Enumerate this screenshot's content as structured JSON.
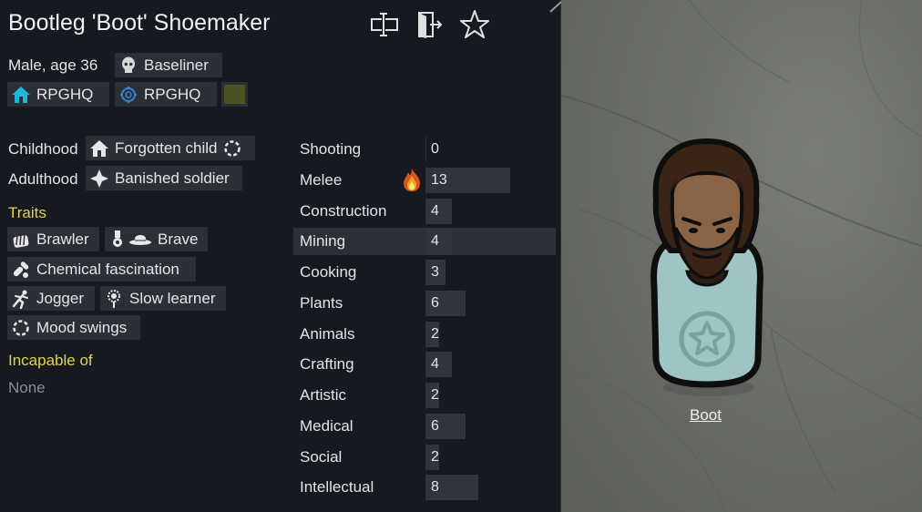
{
  "pawn": {
    "full_name": "Bootleg 'Boot' Shoemaker",
    "desc": "Male, age 36",
    "xenotype": "Baseliner",
    "faction": "RPGHQ",
    "ideo": "RPGHQ",
    "short_name": "Boot"
  },
  "header_icons": [
    "rename-icon",
    "banish-icon",
    "favorite-star-icon"
  ],
  "backstory": {
    "childhood_label": "Childhood",
    "childhood": "Forgotten child",
    "adulthood_label": "Adulthood",
    "adulthood": "Banished soldier"
  },
  "traits": {
    "heading": "Traits",
    "items": [
      "Brawler",
      "Brave",
      "Chemical fascination",
      "Jogger",
      "Slow learner",
      "Mood swings"
    ]
  },
  "incapable": {
    "heading": "Incapable of",
    "value": "None"
  },
  "skills": [
    {
      "name": "Shooting",
      "level": 0,
      "passion": "none"
    },
    {
      "name": "Melee",
      "level": 13,
      "passion": "burning"
    },
    {
      "name": "Construction",
      "level": 4,
      "passion": "none"
    },
    {
      "name": "Mining",
      "level": 4,
      "passion": "none"
    },
    {
      "name": "Cooking",
      "level": 3,
      "passion": "none"
    },
    {
      "name": "Plants",
      "level": 6,
      "passion": "none"
    },
    {
      "name": "Animals",
      "level": 2,
      "passion": "none"
    },
    {
      "name": "Crafting",
      "level": 4,
      "passion": "none"
    },
    {
      "name": "Artistic",
      "level": 2,
      "passion": "none"
    },
    {
      "name": "Medical",
      "level": 6,
      "passion": "none"
    },
    {
      "name": "Social",
      "level": 2,
      "passion": "none"
    },
    {
      "name": "Intellectual",
      "level": 8,
      "passion": "none"
    }
  ],
  "skill_max": 20,
  "colors": {
    "panel_bg": "#161a20",
    "chip_bg": "#2b2f36",
    "heading_yellow": "#e3d348",
    "faction_icon": "#1fb6d8",
    "ideo_icon": "#3f7fd6",
    "favorite_color": "#4b5324"
  }
}
